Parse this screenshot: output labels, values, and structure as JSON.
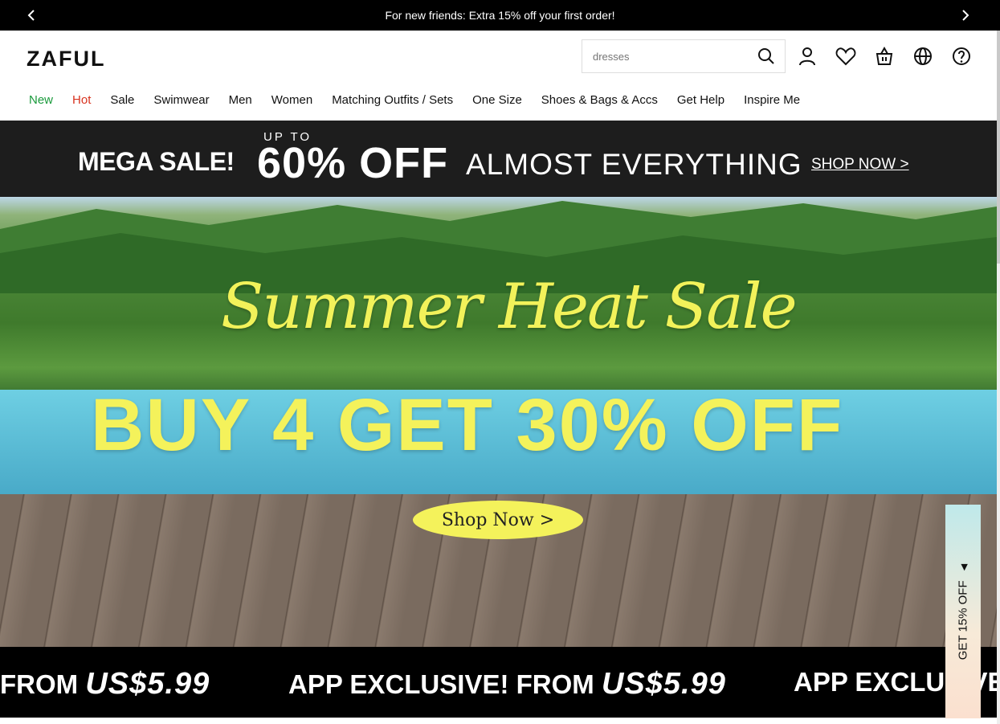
{
  "announcement": {
    "text": "For new friends: Extra 15% off your first order!"
  },
  "header": {
    "logo": "ZAFUL",
    "search_placeholder": "dresses"
  },
  "nav": {
    "items": [
      "New",
      "Hot",
      "Sale",
      "Swimwear",
      "Men",
      "Women",
      "Matching Outfits / Sets",
      "One Size",
      "Shoes & Bags & Accs",
      "Get Help",
      "Inspire Me"
    ]
  },
  "mega_banner": {
    "headline": "MEGA SALE!",
    "up_to": "UP TO",
    "percent": "60% OFF",
    "tagline": "ALMOST EVERYTHING",
    "cta": "SHOP NOW >"
  },
  "hero": {
    "script_title": "Summer Heat Sale",
    "offer": "BUY 4 GET 30% OFF",
    "cta": "Shop Now >"
  },
  "ticker": {
    "item1_lead": "FROM",
    "item1_price": "US$5.99",
    "item2_lead": "APP EXCLUSIVE! FROM",
    "item2_price": "US$5.99",
    "item3_lead": "APP EXCLUSIVE!"
  },
  "side_tab": {
    "label": "GET 15% OFF"
  },
  "colors": {
    "accent_yellow": "#f4f25b",
    "new_green": "#1a9a3c",
    "hot_red": "#d8331f"
  }
}
